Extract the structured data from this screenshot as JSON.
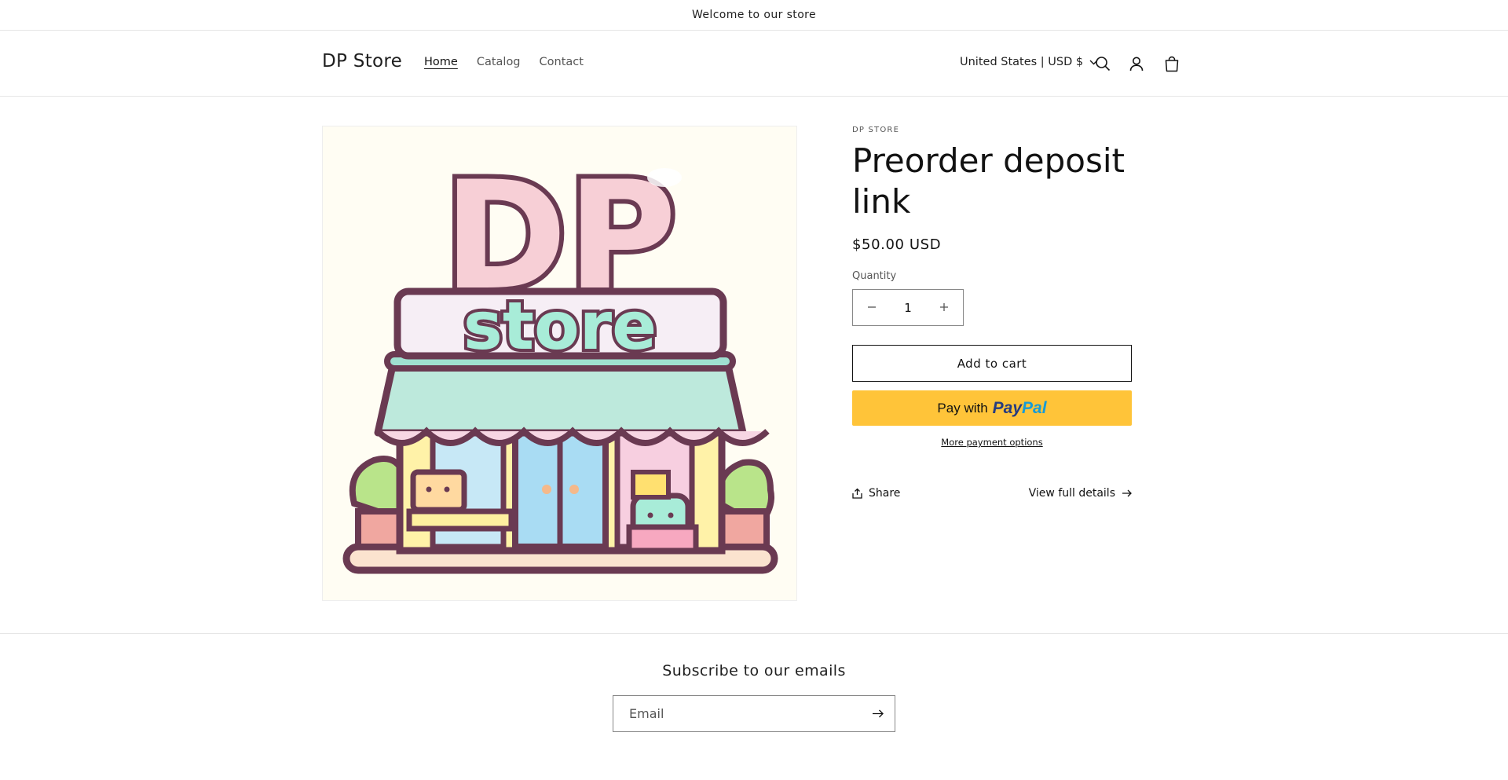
{
  "announcement": {
    "text": "Welcome to our store"
  },
  "header": {
    "logo": "DP Store",
    "nav": [
      {
        "label": "Home",
        "active": true
      },
      {
        "label": "Catalog",
        "active": false
      },
      {
        "label": "Contact",
        "active": false
      }
    ],
    "localization": "United States | USD $",
    "icons": [
      "search-icon",
      "account-icon",
      "cart-icon"
    ]
  },
  "product": {
    "image": {
      "logo_line1": "DP",
      "logo_line2": "store"
    },
    "vendor": "DP STORE",
    "title": "Preorder deposit link",
    "price": "$50.00 USD",
    "quantity_label": "Quantity",
    "quantity_value": "1",
    "add_to_cart": "Add to cart",
    "paypal_prefix": "Pay with",
    "paypal_brand_1": "Pay",
    "paypal_brand_2": "Pal",
    "more_payment": "More payment options",
    "share": "Share",
    "view_details": "View full details"
  },
  "footer": {
    "subscribe_title": "Subscribe to our emails",
    "email_placeholder": "Email"
  },
  "colors": {
    "paypal_yellow": "#ffc439",
    "paypal_dark": "#253b80",
    "paypal_light": "#179bd7"
  }
}
